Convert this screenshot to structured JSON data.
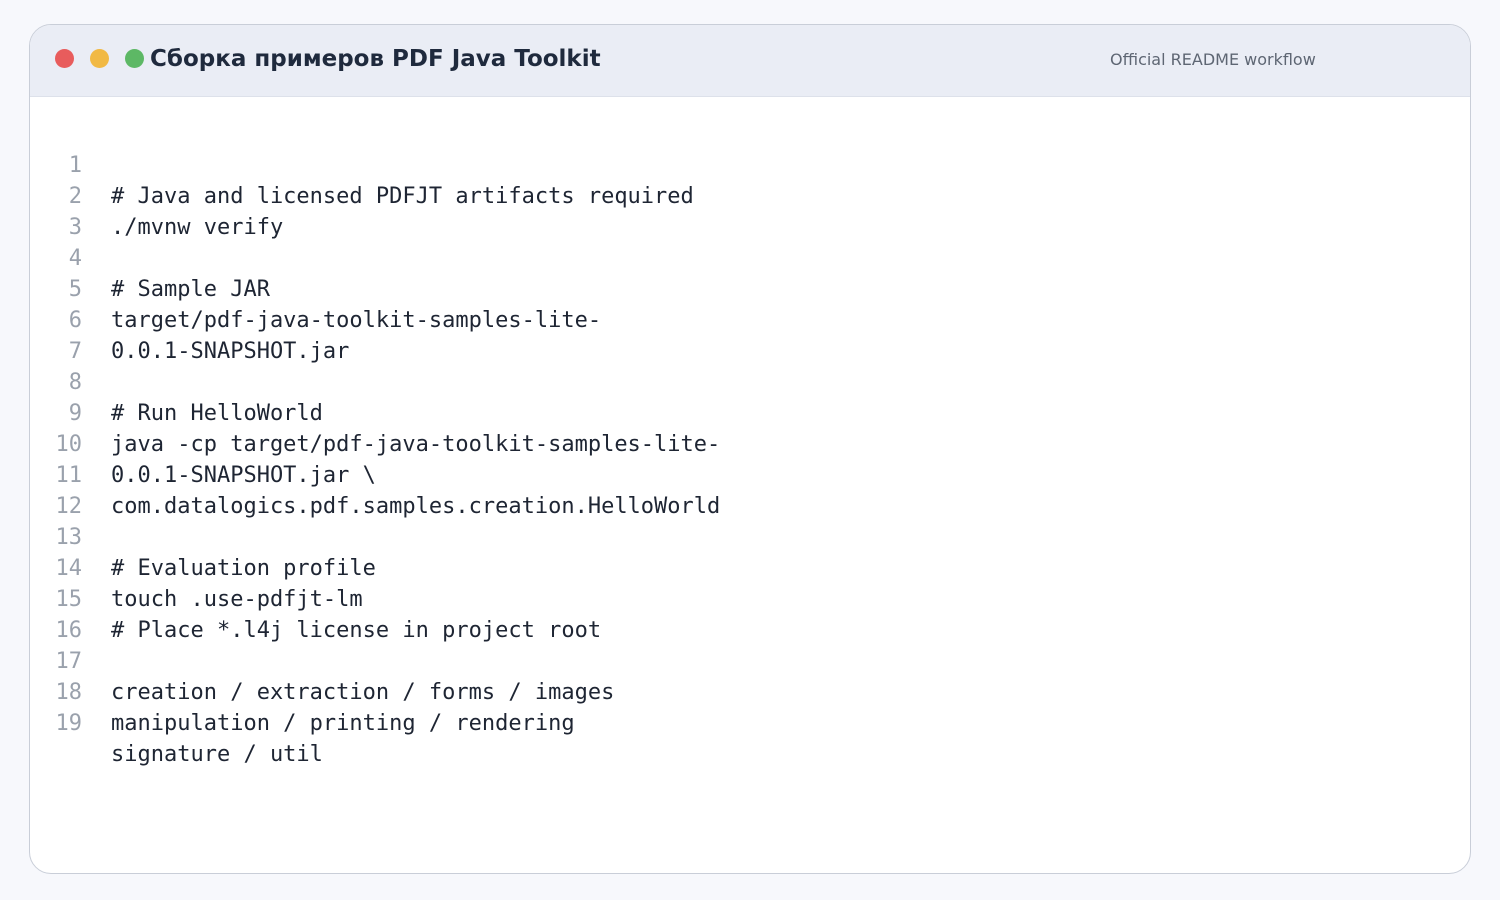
{
  "window": {
    "title": "Сборка примеров PDF Java Toolkit",
    "subtitle": "Official README workflow",
    "controls": {
      "close_color": "#e85c5c",
      "minimize_color": "#f1b944",
      "maximize_color": "#5db865"
    }
  },
  "editor": {
    "lines": [
      {
        "num": "1",
        "text": "# Java and licensed PDFJT artifacts required"
      },
      {
        "num": "2",
        "text": "./mvnw verify"
      },
      {
        "num": "3",
        "text": ""
      },
      {
        "num": "4",
        "text": "# Sample JAR"
      },
      {
        "num": "5",
        "text": "target/pdf-java-toolkit-samples-lite-"
      },
      {
        "num": "6",
        "text": "0.0.1-SNAPSHOT.jar"
      },
      {
        "num": "7",
        "text": ""
      },
      {
        "num": "8",
        "text": "# Run HelloWorld"
      },
      {
        "num": "9",
        "text": "java -cp target/pdf-java-toolkit-samples-lite-"
      },
      {
        "num": "10",
        "text": "0.0.1-SNAPSHOT.jar \\"
      },
      {
        "num": "11",
        "text": "com.datalogics.pdf.samples.creation.HelloWorld"
      },
      {
        "num": "12",
        "text": ""
      },
      {
        "num": "13",
        "text": "# Evaluation profile"
      },
      {
        "num": "14",
        "text": "touch .use-pdfjt-lm"
      },
      {
        "num": "15",
        "text": "# Place *.l4j license in project root"
      },
      {
        "num": "16",
        "text": ""
      },
      {
        "num": "17",
        "text": "creation / extraction / forms / images"
      },
      {
        "num": "18",
        "text": "manipulation / printing / rendering"
      },
      {
        "num": "19",
        "text": "signature / util"
      }
    ]
  }
}
